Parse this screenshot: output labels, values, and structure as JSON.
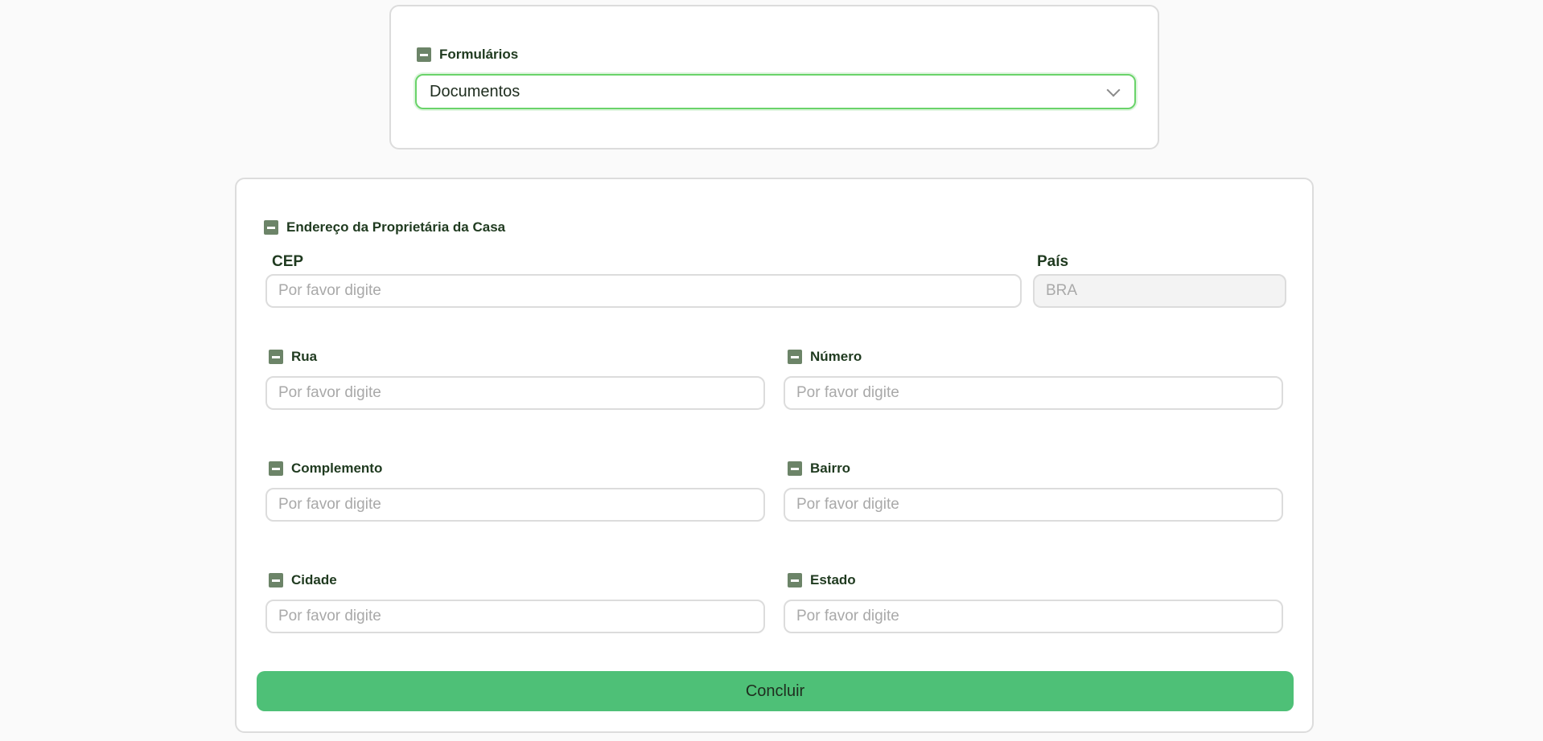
{
  "top_card": {
    "label": "Formulários",
    "select_value": "Documentos"
  },
  "form": {
    "section_title": "Endereço da Proprietária da Casa",
    "cep": {
      "label": "CEP",
      "placeholder": "Por favor digite"
    },
    "pais": {
      "label": "País",
      "placeholder": "BRA"
    },
    "rua": {
      "label": "Rua",
      "placeholder": "Por favor digite"
    },
    "numero": {
      "label": "Número",
      "placeholder": "Por favor digite"
    },
    "complemento": {
      "label": "Complemento",
      "placeholder": "Por favor digite"
    },
    "bairro": {
      "label": "Bairro",
      "placeholder": "Por favor digite"
    },
    "cidade": {
      "label": "Cidade",
      "placeholder": "Por favor digite"
    },
    "estado": {
      "label": "Estado",
      "placeholder": "Por favor digite"
    },
    "submit_label": "Concluir"
  },
  "colors": {
    "accent_green": "#4ec077",
    "focus_border": "#6ad36a",
    "icon_green": "#6c8468"
  }
}
